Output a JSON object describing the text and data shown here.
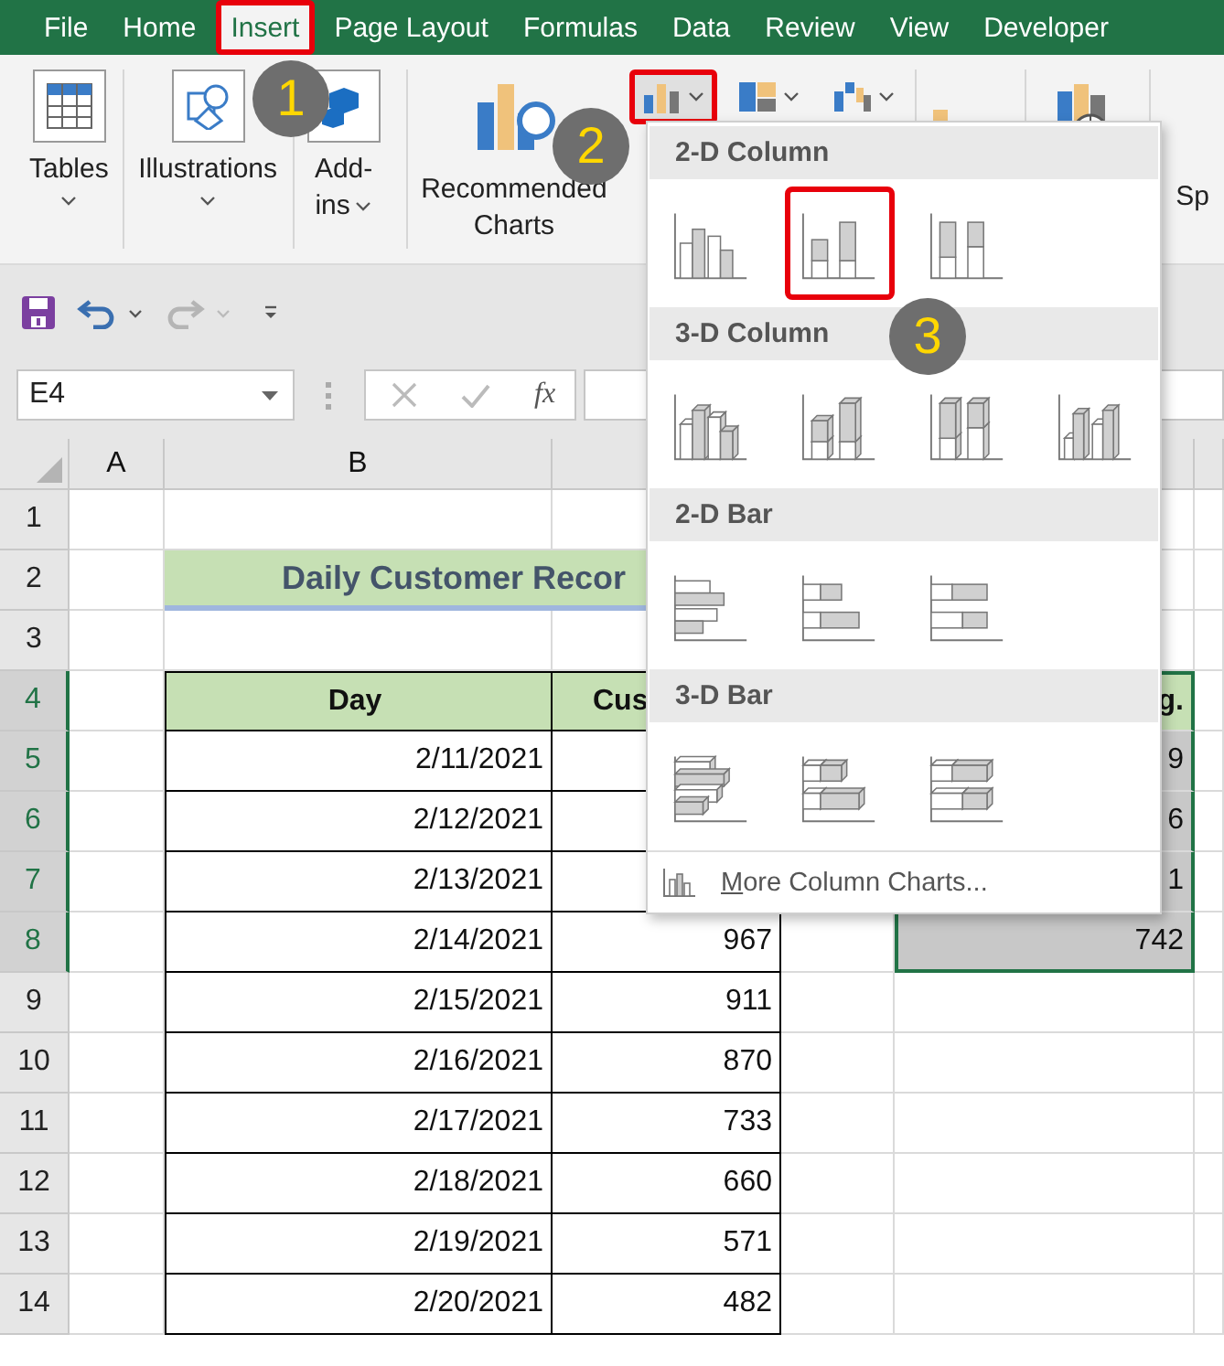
{
  "ribbon_tabs": [
    {
      "label": "File",
      "selected": false,
      "highlighted": false
    },
    {
      "label": "Home",
      "selected": false,
      "highlighted": false
    },
    {
      "label": "Insert",
      "selected": true,
      "highlighted": true
    },
    {
      "label": "Page Layout",
      "selected": false,
      "highlighted": false
    },
    {
      "label": "Formulas",
      "selected": false,
      "highlighted": false
    },
    {
      "label": "Data",
      "selected": false,
      "highlighted": false
    },
    {
      "label": "Review",
      "selected": false,
      "highlighted": false
    },
    {
      "label": "View",
      "selected": false,
      "highlighted": false
    },
    {
      "label": "Developer",
      "selected": false,
      "highlighted": false
    }
  ],
  "ribbon_groups": [
    {
      "kind": "tables",
      "lines": [
        "Tables"
      ],
      "dropdown": true
    },
    {
      "kind": "illustrations",
      "lines": [
        "Illustrations"
      ],
      "dropdown": true
    },
    {
      "kind": "add-ins",
      "lines": [
        "Add-",
        "ins"
      ],
      "dropdown": true
    },
    {
      "kind": "recommended-charts",
      "lines": [
        "Recommended",
        "Charts"
      ]
    },
    {
      "kind": "chart-buttons",
      "buttons": [
        {
          "kind": "column",
          "highlighted": true
        },
        {
          "kind": "hierarchy",
          "highlighted": false
        },
        {
          "kind": "waterfall",
          "highlighted": false
        }
      ]
    },
    {
      "kind": "pivot-chart"
    },
    {
      "kind": "maps"
    },
    {
      "kind": "sparklines",
      "lines": [
        "Sp"
      ]
    }
  ],
  "quick_access": {
    "undo": {
      "disabled": false
    },
    "redo": {
      "disabled": true
    }
  },
  "formula_bar": {
    "name_box": "E4",
    "function_label": "fx"
  },
  "sheet": {
    "column_headers": [
      "A",
      "B"
    ],
    "row_headers": [
      {
        "label": "1",
        "selected": false
      },
      {
        "label": "2",
        "selected": false
      },
      {
        "label": "3",
        "selected": false
      },
      {
        "label": "4",
        "selected": true
      },
      {
        "label": "5",
        "selected": true
      },
      {
        "label": "6",
        "selected": true
      },
      {
        "label": "7",
        "selected": true
      },
      {
        "label": "8",
        "selected": true
      },
      {
        "label": "9",
        "selected": false
      },
      {
        "label": "10",
        "selected": false
      },
      {
        "label": "11",
        "selected": false
      },
      {
        "label": "12",
        "selected": false
      },
      {
        "label": "13",
        "selected": false
      },
      {
        "label": "14",
        "selected": false
      }
    ],
    "title": "Daily Customer Recor",
    "table_header": {
      "day": "Day",
      "customers": "Cus",
      "average": "g."
    },
    "records": [
      {
        "day": "2/11/2021",
        "average": "9"
      },
      {
        "day": "2/12/2021",
        "average": "6"
      },
      {
        "day": "2/13/2021",
        "average": "1"
      },
      {
        "day": "2/14/2021",
        "customers": "967",
        "average": "742"
      },
      {
        "day": "2/15/2021",
        "customers": "911"
      },
      {
        "day": "2/16/2021",
        "customers": "870"
      },
      {
        "day": "2/17/2021",
        "customers": "733"
      },
      {
        "day": "2/18/2021",
        "customers": "660"
      },
      {
        "day": "2/19/2021",
        "customers": "571"
      },
      {
        "day": "2/20/2021",
        "customers": "482"
      }
    ]
  },
  "chart_menu": {
    "sections": [
      {
        "title": "2-D Column",
        "kind": "column",
        "items": [
          {
            "kind": "clustered",
            "highlighted": false
          },
          {
            "kind": "stacked",
            "highlighted": true
          },
          {
            "kind": "percent",
            "highlighted": false
          }
        ]
      },
      {
        "title": "3-D Column",
        "kind": "column3d",
        "items": [
          {
            "kind": "clustered",
            "highlighted": false
          },
          {
            "kind": "stacked",
            "highlighted": false
          },
          {
            "kind": "percent",
            "highlighted": false
          },
          {
            "kind": "depth",
            "highlighted": false
          }
        ]
      },
      {
        "title": "2-D Bar",
        "kind": "bar",
        "items": [
          {
            "kind": "clustered",
            "highlighted": false
          },
          {
            "kind": "stacked",
            "highlighted": false
          },
          {
            "kind": "percent",
            "highlighted": false
          }
        ]
      },
      {
        "title": "3-D Bar",
        "kind": "bar3d",
        "items": [
          {
            "kind": "clustered",
            "highlighted": false
          },
          {
            "kind": "stacked",
            "highlighted": false
          },
          {
            "kind": "percent",
            "highlighted": false
          }
        ]
      }
    ],
    "more_link": "More Column Charts..."
  },
  "callouts": [
    {
      "label": "1"
    },
    {
      "label": "2"
    },
    {
      "label": "3"
    }
  ]
}
